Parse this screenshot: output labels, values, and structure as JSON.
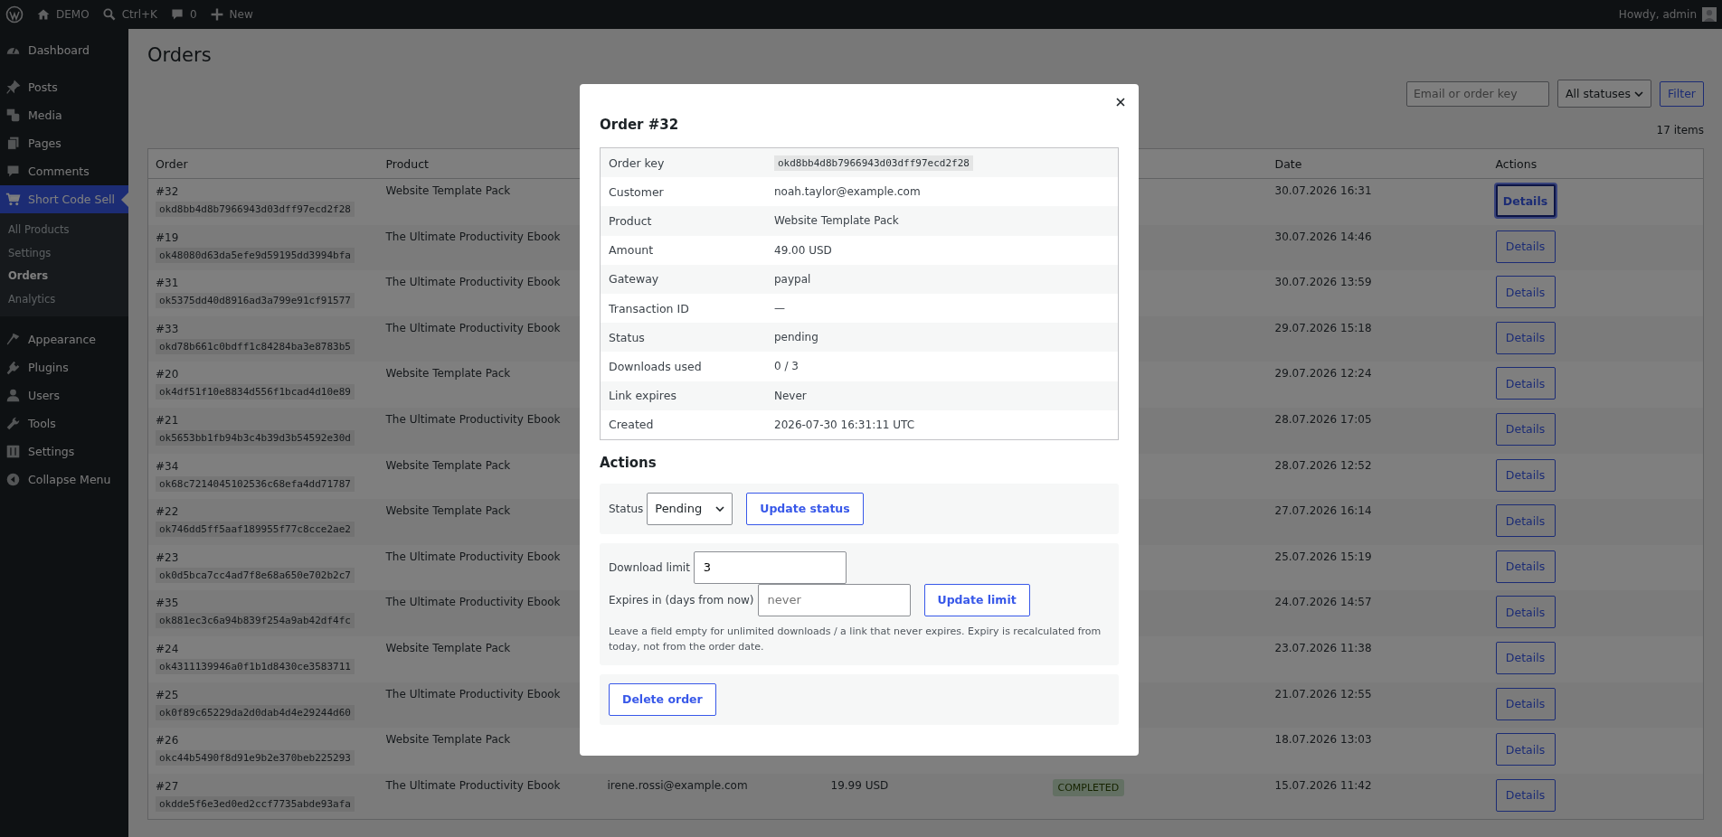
{
  "admin_bar": {
    "site_name": "DEMO",
    "search_shortcut": "Ctrl+K",
    "comments_count": "0",
    "new_label": "New",
    "greeting": "Howdy, admin"
  },
  "sidebar": {
    "groups": [
      [
        {
          "label": "Dashboard",
          "selected": false
        }
      ],
      [
        {
          "label": "Posts",
          "selected": false
        },
        {
          "label": "Media",
          "selected": false
        },
        {
          "label": "Pages",
          "selected": false
        },
        {
          "label": "Comments",
          "selected": false
        },
        {
          "label": "Short Code Sell",
          "selected": true,
          "children": [
            {
              "label": "All Products",
              "selected": false
            },
            {
              "label": "Settings",
              "selected": false
            },
            {
              "label": "Orders",
              "selected": true
            },
            {
              "label": "Analytics",
              "selected": false
            }
          ]
        }
      ],
      [
        {
          "label": "Appearance",
          "selected": false
        },
        {
          "label": "Plugins",
          "selected": false
        },
        {
          "label": "Users",
          "selected": false
        },
        {
          "label": "Tools",
          "selected": false
        },
        {
          "label": "Settings",
          "selected": false
        },
        {
          "label": "Collapse Menu",
          "selected": false
        }
      ]
    ]
  },
  "page": {
    "title": "Orders",
    "search": {
      "placeholder": "Email or order key"
    },
    "status_filter": {
      "value": "All statuses"
    },
    "filter_button": "Filter",
    "item_count": "17 items"
  },
  "table": {
    "columns": {
      "order": "Order",
      "product": "Product",
      "date": "Date",
      "actions": "Actions"
    },
    "rows": [
      {
        "number": "#32",
        "order_key": "okd8bb4d8b7966943d03dff97ecd2f28",
        "product": "Website Template Pack",
        "date": "30.07.2026 16:31",
        "action": "Details",
        "focused": true
      },
      {
        "number": "#19",
        "order_key": "ok48080d63da5efe9d59195dd3994bfa",
        "product": "The Ultimate Productivity Ebook",
        "date": "30.07.2026 14:46",
        "action": "Details",
        "focused": false
      },
      {
        "number": "#31",
        "order_key": "ok5375dd40d8916ad3a799e91cf91577",
        "product": "The Ultimate Productivity Ebook",
        "date": "30.07.2026 13:59",
        "action": "Details",
        "focused": false
      },
      {
        "number": "#33",
        "order_key": "okd78b661c0bdff1c84284ba3e8783b5",
        "product": "The Ultimate Productivity Ebook",
        "date": "29.07.2026 15:18",
        "action": "Details",
        "focused": false
      },
      {
        "number": "#20",
        "order_key": "ok4df51f10e8834d556f1bcad4d10e89",
        "product": "Website Template Pack",
        "date": "29.07.2026 12:24",
        "action": "Details",
        "focused": false
      },
      {
        "number": "#21",
        "order_key": "ok5653bb1fb94b3c4b39d3b54592e30d",
        "product": "The Ultimate Productivity Ebook",
        "date": "28.07.2026 17:05",
        "action": "Details",
        "focused": false
      },
      {
        "number": "#34",
        "order_key": "ok68c7214045102536c68efa4dd71787",
        "product": "Website Template Pack",
        "date": "28.07.2026 12:52",
        "action": "Details",
        "focused": false
      },
      {
        "number": "#22",
        "order_key": "ok746dd5ff5aaf189955f77c8cce2ae2",
        "product": "Website Template Pack",
        "date": "27.07.2026 16:14",
        "action": "Details",
        "focused": false
      },
      {
        "number": "#23",
        "order_key": "ok0d5bca7cc4ad7f8e68a650e702b2c7",
        "product": "The Ultimate Productivity Ebook",
        "date": "25.07.2026 15:19",
        "action": "Details",
        "focused": false
      },
      {
        "number": "#35",
        "order_key": "ok881ec3c6a94b839f254a9ab42df4fc",
        "product": "The Ultimate Productivity Ebook",
        "date": "24.07.2026 14:57",
        "action": "Details",
        "focused": false
      },
      {
        "number": "#24",
        "order_key": "ok4311139946a0f1b1d8430ce3583711",
        "product": "Website Template Pack",
        "date": "23.07.2026 11:38",
        "action": "Details",
        "focused": false
      },
      {
        "number": "#25",
        "order_key": "ok0f89c65229da2d0dab4d4e29244d60",
        "product": "The Ultimate Productivity Ebook",
        "date": "21.07.2026 12:55",
        "action": "Details",
        "focused": false
      },
      {
        "number": "#26",
        "order_key": "okc44b5490f8d91e9b2e370beb225293",
        "product": "Website Template Pack",
        "date": "18.07.2026 13:03",
        "action": "Details",
        "focused": false
      },
      {
        "number": "#27",
        "order_key": "okdde5f6e3ed0ed2ccf7735abde93afa",
        "product": "The Ultimate Productivity Ebook",
        "customer": "irene.rossi@example.com",
        "amount": "19.99 USD",
        "status": "COMPLETED",
        "date": "15.07.2026 11:42",
        "action": "Details",
        "focused": false
      }
    ]
  },
  "modal": {
    "title": "Order #32",
    "details": [
      {
        "label": "Order key",
        "value": "okd8bb4d8b7966943d03dff97ecd2f28",
        "kind": "code"
      },
      {
        "label": "Customer",
        "value": "noah.taylor@example.com",
        "kind": "text"
      },
      {
        "label": "Product",
        "value": "Website Template Pack",
        "kind": "text"
      },
      {
        "label": "Amount",
        "value": "49.00 USD",
        "kind": "text"
      },
      {
        "label": "Gateway",
        "value": "paypal",
        "kind": "text"
      },
      {
        "label": "Transaction ID",
        "value": "—",
        "kind": "text"
      },
      {
        "label": "Status",
        "value": "pending",
        "kind": "text"
      },
      {
        "label": "Downloads used",
        "value": "0 / 3",
        "kind": "text"
      },
      {
        "label": "Link expires",
        "value": "Never",
        "kind": "text"
      },
      {
        "label": "Created",
        "value": "2026-07-30 16:31:11 UTC",
        "kind": "text"
      }
    ],
    "actions_heading": "Actions",
    "status_form": {
      "label": "Status",
      "value": "Pending",
      "button": "Update status"
    },
    "limit_form": {
      "download_limit_label": "Download limit",
      "download_limit_value": "3",
      "expires_label": "Expires in (days from now)",
      "expires_placeholder": "never",
      "button": "Update limit",
      "help": "Leave a field empty for unlimited downloads / a link that never expires. Expiry is recalculated from today, not from the order date."
    },
    "delete_button": "Delete order"
  }
}
